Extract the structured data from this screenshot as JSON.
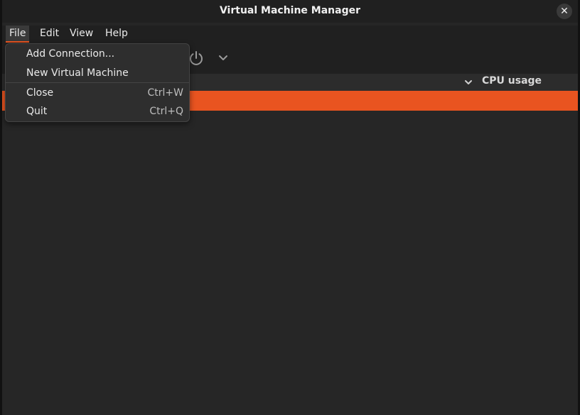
{
  "window": {
    "title": "Virtual Machine Manager",
    "close_label": "✕"
  },
  "menubar": {
    "items": [
      {
        "label": "File"
      },
      {
        "label": "Edit"
      },
      {
        "label": "View"
      },
      {
        "label": "Help"
      }
    ]
  },
  "file_menu": {
    "items": [
      {
        "label": "Add Connection...",
        "accel": ""
      },
      {
        "label": "New Virtual Machine",
        "accel": ""
      },
      {
        "label": "Close",
        "accel": "Ctrl+W"
      },
      {
        "label": "Quit",
        "accel": "Ctrl+Q"
      }
    ]
  },
  "list": {
    "columns": {
      "cpu_usage": "CPU usage"
    }
  },
  "icons": {
    "power": "power-icon",
    "chevron": "chevron-down-icon",
    "close": "close-icon"
  },
  "colors": {
    "accent": "#e95420",
    "background": "#262626",
    "bar": "#202020"
  }
}
